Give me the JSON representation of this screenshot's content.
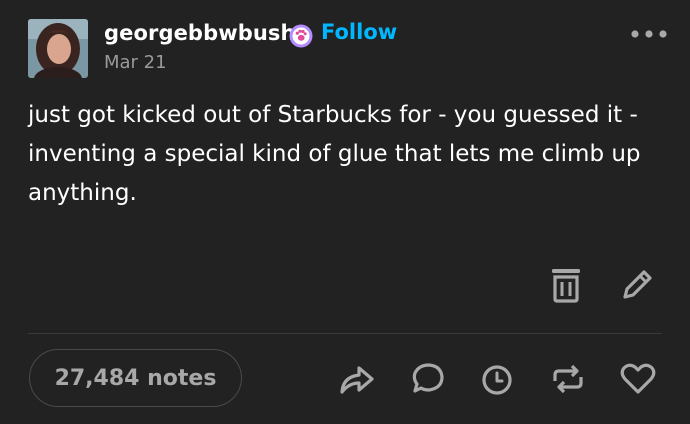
{
  "post": {
    "username": "georgebbwbush",
    "follow_label": "Follow",
    "date": "Mar 21",
    "body": "just got kicked out of Starbucks for - you guessed it - inventing a special kind of glue that lets me climb up anything.",
    "notes": "27,484 notes"
  },
  "icons": {
    "badge": "paw-badge-icon",
    "more": "more-horizontal-icon",
    "delete": "trash-icon",
    "edit": "pencil-icon",
    "share": "share-icon",
    "reply": "reply-bubble-icon",
    "queue": "clock-icon",
    "reblog": "reblog-icon",
    "like": "heart-icon"
  },
  "colors": {
    "background": "#222222",
    "follow": "#00b8ff",
    "badge": "#b38dff",
    "muted": "#9a9a9a",
    "icon": "#a8a8a8"
  }
}
